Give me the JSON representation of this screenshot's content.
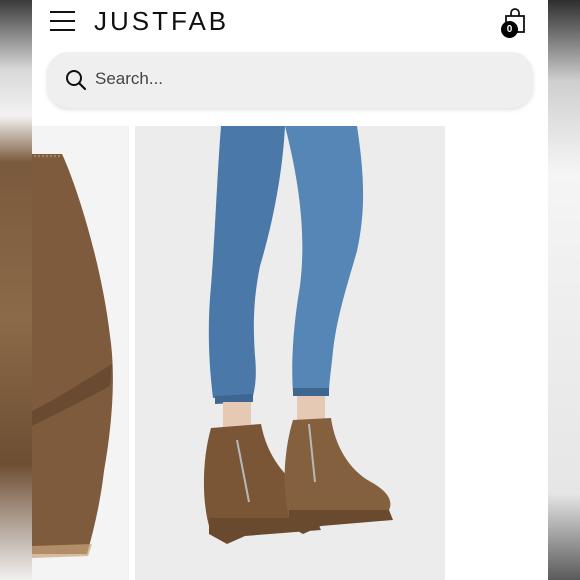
{
  "header": {
    "brand": "JUSTFAB",
    "bag_count": "0"
  },
  "search": {
    "placeholder": "Search..."
  },
  "gallery": {
    "images": [
      {
        "alt": "boot-closeup"
      },
      {
        "alt": "model-wearing-wedge-booties"
      }
    ]
  },
  "colors": {
    "suede": "#7a5637",
    "denim": "#4c78a8",
    "search_bg": "#efefef"
  }
}
